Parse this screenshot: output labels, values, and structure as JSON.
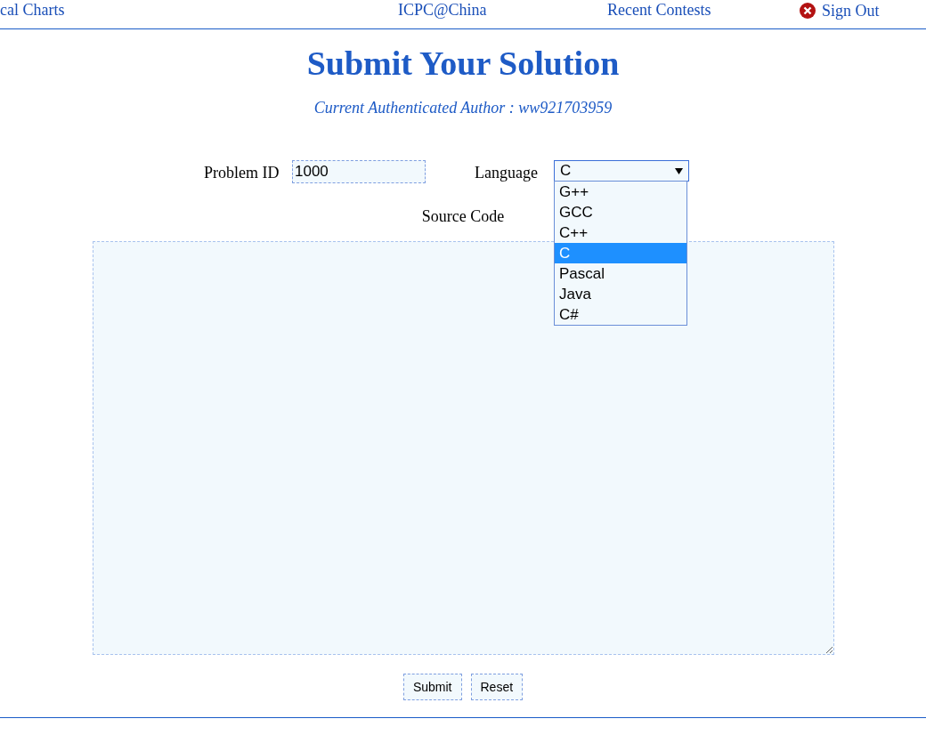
{
  "nav": [
    {
      "label": "cal Charts"
    },
    {
      "label": "ICPC@China"
    },
    {
      "label": "Recent Contests"
    },
    {
      "label": "Sign Out",
      "kind": "signout"
    }
  ],
  "title": "Submit Your Solution",
  "author": "Current Authenticated Author : ww921703959",
  "form": {
    "problem_label": "Problem ID",
    "problem_value": "1000",
    "language_label": "Language",
    "language_value": "C",
    "expanded": true,
    "options": [
      {
        "label": "G++",
        "selected": false
      },
      {
        "label": "GCC",
        "selected": false
      },
      {
        "label": "C++",
        "selected": false
      },
      {
        "label": "C",
        "selected": true
      },
      {
        "label": "Pascal",
        "selected": false
      },
      {
        "label": "Java",
        "selected": false
      },
      {
        "label": "C#",
        "selected": false
      }
    ],
    "source_label": "Source Code"
  },
  "buttons": [
    "Submit",
    "Reset"
  ]
}
